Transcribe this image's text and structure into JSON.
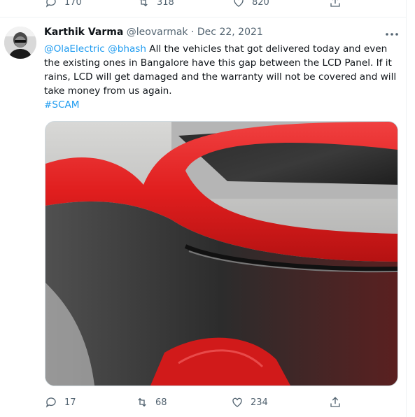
{
  "prev_tweet": {
    "replies": "170",
    "retweets": "318",
    "likes": "820"
  },
  "tweet": {
    "author_name": "Karthik Varma",
    "handle": "@leovarmak",
    "separator": "·",
    "date": "Dec 22, 2021",
    "mention_1": "@OlaElectric",
    "mention_2": "@bhash",
    "text": " All the vehicles that got delivered today and even the existing ones in Bangalore have this gap between the LCD Panel. If it rains, LCD will get damaged and the warranty will not be covered and will take money from us again.",
    "hashtag": "#SCAM",
    "replies": "17",
    "retweets": "68",
    "likes": "234"
  },
  "icons": {
    "reply": "reply-icon",
    "retweet": "retweet-icon",
    "like": "heart-icon",
    "share": "share-icon",
    "more": "more-icon"
  },
  "colors": {
    "link": "#1d9bf0",
    "secondary_text": "#536471",
    "scooter_red": "#e01e1e"
  }
}
